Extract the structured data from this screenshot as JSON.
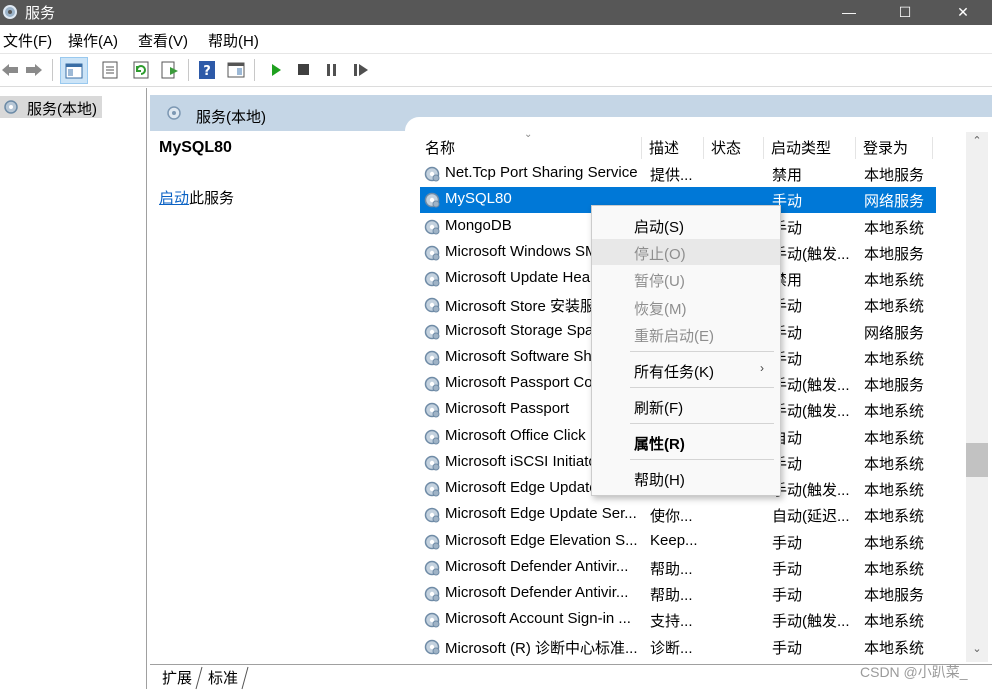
{
  "window": {
    "title": "服务",
    "controls": [
      "—",
      "☐",
      "✕"
    ]
  },
  "menu": [
    "文件(F)",
    "操作(A)",
    "查看(V)",
    "帮助(H)"
  ],
  "tree": {
    "root_label": "服务(本地)"
  },
  "main": {
    "header": "服务(本地)",
    "selected_service": "MySQL80",
    "start_link": "启动",
    "start_suffix": "此服务"
  },
  "columns": [
    "名称",
    "描述",
    "状态",
    "启动类型",
    "登录为"
  ],
  "services": [
    {
      "name": "Net.Tcp Port Sharing Service",
      "desc": "提供...",
      "status": "",
      "startup": "禁用",
      "logon": "本地服务"
    },
    {
      "name": "MySQL80",
      "desc": "",
      "status": "",
      "startup": "手动",
      "logon": "网络服务"
    },
    {
      "name": "MongoDB",
      "desc": "",
      "status": "",
      "startup": "手动",
      "logon": "本地系统"
    },
    {
      "name": "Microsoft Windows SMS",
      "desc": "",
      "status": "",
      "startup": "手动(触发...",
      "logon": "本地服务"
    },
    {
      "name": "Microsoft Update Health",
      "desc": "",
      "status": "",
      "startup": "禁用",
      "logon": "本地系统"
    },
    {
      "name": "Microsoft Store 安装服务",
      "desc": "",
      "status": "",
      "startup": "手动",
      "logon": "本地系统"
    },
    {
      "name": "Microsoft Storage Spaces",
      "desc": "",
      "status": "",
      "startup": "手动",
      "logon": "网络服务"
    },
    {
      "name": "Microsoft Software Shadow",
      "desc": "",
      "status": "",
      "startup": "手动",
      "logon": "本地系统"
    },
    {
      "name": "Microsoft Passport Container",
      "desc": "",
      "status": "",
      "startup": "手动(触发...",
      "logon": "本地服务"
    },
    {
      "name": "Microsoft Passport",
      "desc": "",
      "status": "",
      "startup": "手动(触发...",
      "logon": "本地系统"
    },
    {
      "name": "Microsoft Office Click",
      "desc": "",
      "status": "",
      "startup": "自动",
      "logon": "本地系统"
    },
    {
      "name": "Microsoft iSCSI Initiator",
      "desc": "",
      "status": "",
      "startup": "手动",
      "logon": "本地系统"
    },
    {
      "name": "Microsoft Edge Update",
      "desc": "",
      "status": "",
      "startup": "手动(触发...",
      "logon": "本地系统"
    },
    {
      "name": "Microsoft Edge Update Ser...",
      "desc": "使你...",
      "status": "",
      "startup": "自动(延迟...",
      "logon": "本地系统"
    },
    {
      "name": "Microsoft Edge Elevation S...",
      "desc": "Keep...",
      "status": "",
      "startup": "手动",
      "logon": "本地系统"
    },
    {
      "name": "Microsoft Defender Antivir...",
      "desc": "帮助...",
      "status": "",
      "startup": "手动",
      "logon": "本地系统"
    },
    {
      "name": "Microsoft Defender Antivir...",
      "desc": "帮助...",
      "status": "",
      "startup": "手动",
      "logon": "本地服务"
    },
    {
      "name": "Microsoft Account Sign-in ...",
      "desc": "支持...",
      "status": "",
      "startup": "手动(触发...",
      "logon": "本地系统"
    },
    {
      "name": "Microsoft (R) 诊断中心标准...",
      "desc": "诊断...",
      "status": "",
      "startup": "手动",
      "logon": "本地系统"
    }
  ],
  "context_menu": {
    "start": "启动(S)",
    "stop": "停止(O)",
    "pause": "暂停(U)",
    "resume": "恢复(M)",
    "restart": "重新启动(E)",
    "all_tasks": "所有任务(K)",
    "refresh": "刷新(F)",
    "properties": "属性(R)",
    "help": "帮助(H)"
  },
  "tabs": [
    "扩展",
    "标准"
  ],
  "watermark": "CSDN @小趴菜_",
  "colors": {
    "selection": "#0078d7",
    "header": "#c5d6e6",
    "link": "#0b62c4"
  },
  "icons": [
    "gear-icon",
    "back-icon",
    "forward-icon",
    "play-icon",
    "stop-icon",
    "pause-icon",
    "resume-icon"
  ]
}
